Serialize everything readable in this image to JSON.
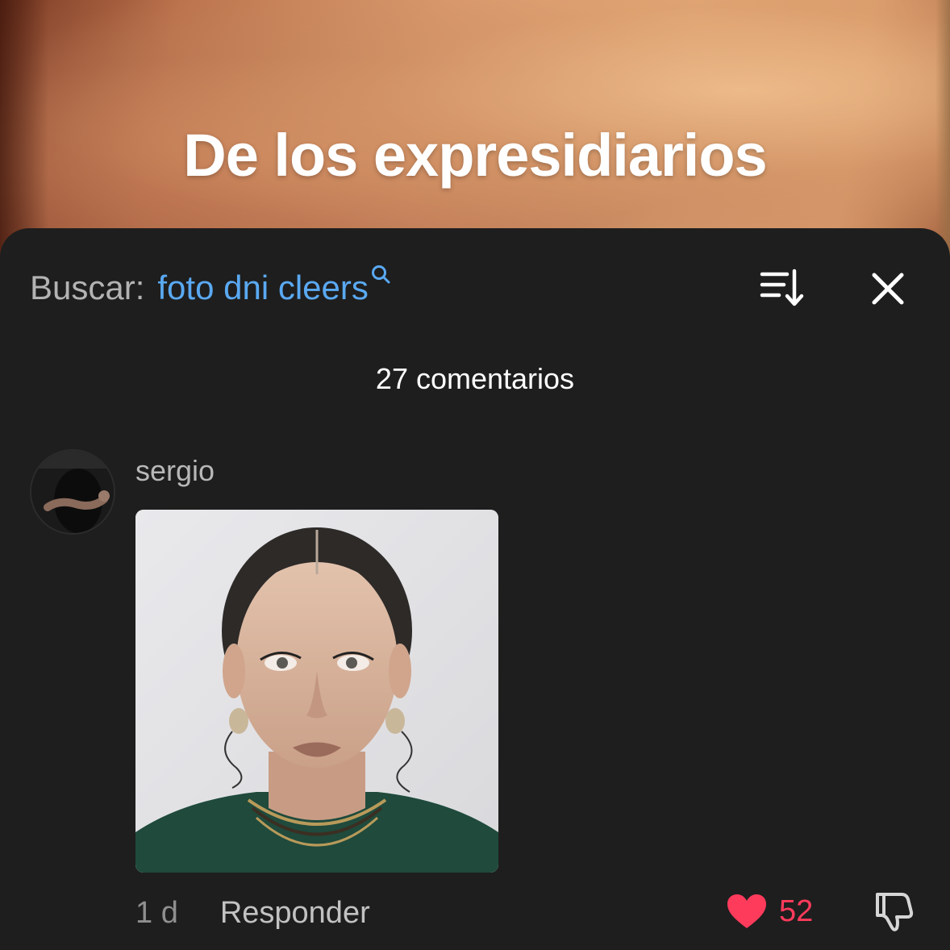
{
  "video": {
    "caption": "De los expresidiarios"
  },
  "search": {
    "prefix": "Buscar:",
    "query": "foto dni cleers",
    "icon": "search-icon"
  },
  "header": {
    "sort_icon": "sort-descending-icon",
    "close_icon": "close-icon"
  },
  "comments": {
    "count_label": "27 comentarios",
    "items": [
      {
        "username": "sergio",
        "time": "1 d",
        "reply_label": "Responder",
        "likes": "52",
        "like_icon": "heart-icon",
        "dislike_icon": "thumbs-down-icon"
      }
    ]
  },
  "colors": {
    "background": "#1e1e1e",
    "search_query": "#5aa9f2",
    "like": "#ff3b5c"
  }
}
